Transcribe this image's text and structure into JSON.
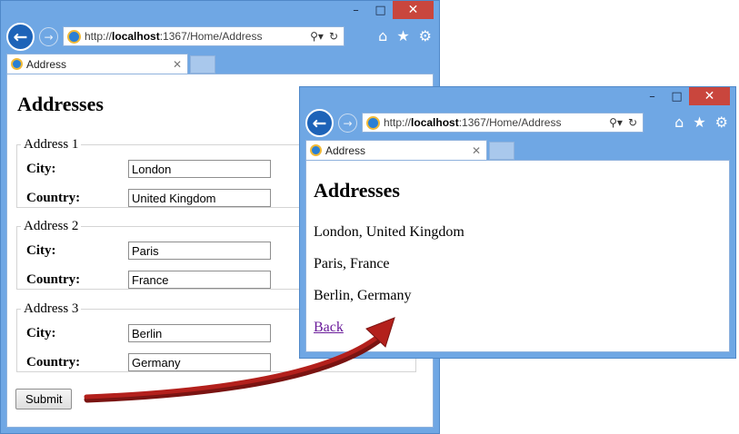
{
  "window1": {
    "url_prefix": "http://",
    "url_host": "localhost",
    "url_rest": ":1367/Home/Address",
    "tab_title": "Address",
    "page_title": "Addresses",
    "addresses": [
      {
        "legend": "Address 1",
        "city_label": "City:",
        "city": "London",
        "country_label": "Country:",
        "country": "United Kingdom"
      },
      {
        "legend": "Address 2",
        "city_label": "City:",
        "city": "Paris",
        "country_label": "Country:",
        "country": "France"
      },
      {
        "legend": "Address 3",
        "city_label": "City:",
        "city": "Berlin",
        "country_label": "Country:",
        "country": "Germany"
      }
    ],
    "submit_label": "Submit"
  },
  "window2": {
    "url_prefix": "http://",
    "url_host": "localhost",
    "url_rest": ":1367/Home/Address",
    "tab_title": "Address",
    "page_title": "Addresses",
    "lines": [
      "London, United Kingdom",
      "Paris, France",
      "Berlin, Germany"
    ],
    "back_label": "Back"
  },
  "icons": {
    "minimize": "minimize-icon",
    "maximize": "maximize-icon",
    "close": "close-icon",
    "back": "back-arrow-icon",
    "forward": "forward-arrow-icon",
    "search": "search-icon",
    "refresh": "refresh-icon",
    "home": "home-icon",
    "favorites": "star-icon",
    "settings": "gear-icon"
  },
  "colors": {
    "frame": "#6fa7e4",
    "close_button": "#c9463d",
    "link_visited": "#6a1b9a",
    "arrow": "#b3201c"
  }
}
